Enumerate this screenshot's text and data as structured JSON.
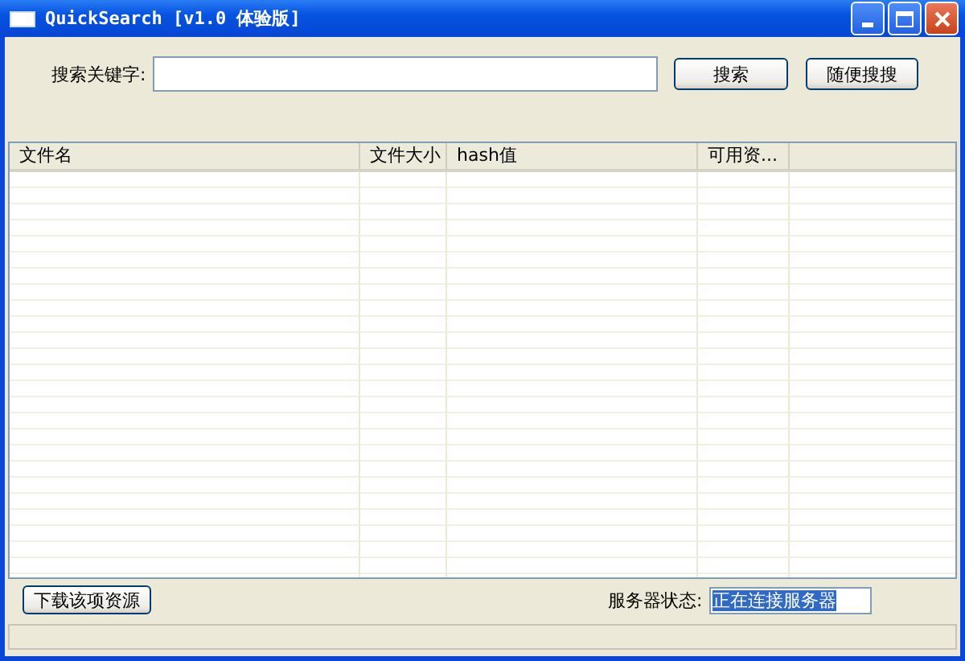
{
  "window": {
    "title": "QuickSearch [v1.0 体验版]"
  },
  "search": {
    "label": "搜索关键字:",
    "buttons": [
      "搜索",
      "随便搜搜"
    ]
  },
  "table": {
    "columns": [
      "文件名",
      "文件大小",
      "hash值",
      "可用资..."
    ]
  },
  "download_button": "下载该项资源",
  "server_status": {
    "label": "服务器状态:",
    "value": "正在连接服务器"
  }
}
